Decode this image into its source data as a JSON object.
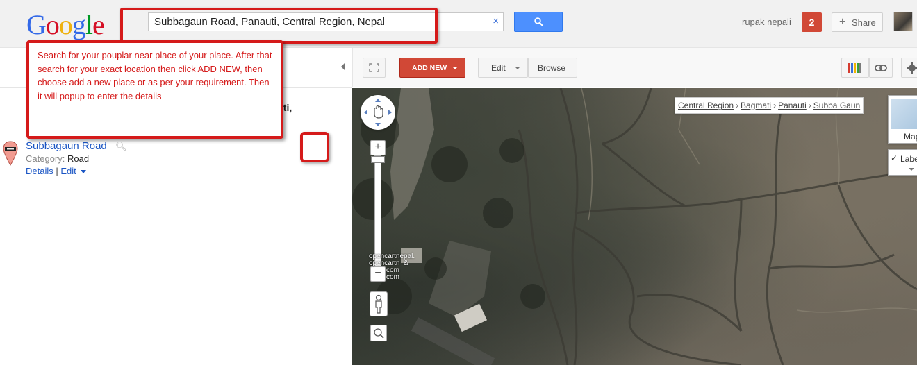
{
  "header": {
    "logo": [
      "G",
      "o",
      "o",
      "g",
      "l",
      "e"
    ],
    "search_value": "Subbagaun Road, Panauti, Central Region, Nepal",
    "clear_symbol": "×",
    "user_name": "rupak nepali",
    "notification_count": "2",
    "share_label": "Share",
    "share_plus": "+"
  },
  "callout": {
    "text": "Search for your pouplar near place of your place. After that search for your exact location then click ADD NEW, then choose add a new place or as per your requirement. Then it will popup to enter the details"
  },
  "left_panel": {
    "obscured_text": "ati,",
    "result": {
      "title": "Subbagaun Road",
      "category_label": "Category:",
      "category_value": "Road",
      "details_link": "Details",
      "separator": "|",
      "edit_link": "Edit"
    }
  },
  "toolbar": {
    "add_new": "ADD NEW",
    "edit": "Edit",
    "browse": "Browse"
  },
  "map": {
    "breadcrumb": [
      "Central Region",
      "Bagmati",
      "Panauti",
      "Subba Gaun"
    ],
    "breadcrumb_separator": "›",
    "map_type_label": "Map",
    "labels_label": "Labels",
    "labels_check": "✓",
    "zoom_in": "+",
    "zoom_out": "−",
    "watermark_text": "opencartnepal.\nopencartn  &\n         com\n         com"
  },
  "colors": {
    "accent_red": "#d51a1a",
    "search_blue": "#4d90fe",
    "add_new_red": "#d14836",
    "link_blue": "#1a55c4"
  }
}
